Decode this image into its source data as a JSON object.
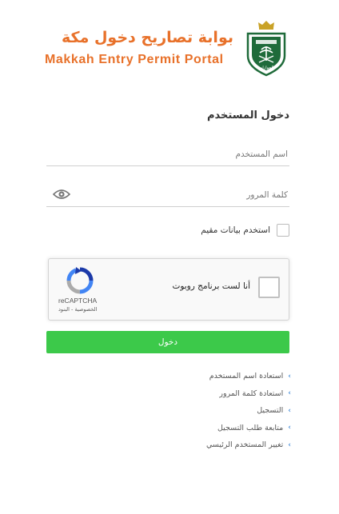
{
  "header": {
    "title_ar": "بوابة تصاريح دخول مكة",
    "title_en": "Makkah Entry Permit Portal",
    "logo_text": "الجوازات"
  },
  "login": {
    "title": "دخول المستخدم",
    "username_placeholder": "اسم المستخدم",
    "password_placeholder": "كلمة المرور",
    "resident_label": "استخدم بيانات مقيم",
    "submit_label": "دخول"
  },
  "captcha": {
    "label": "أنا لست برنامج روبوت",
    "brand": "reCAPTCHA",
    "links": "الخصوصية - البنود"
  },
  "links": [
    {
      "label": "استعادة اسم المستخدم",
      "icon": "chevron-left-icon"
    },
    {
      "label": "استعادة كلمة المرور",
      "icon": "chevron-left-icon"
    },
    {
      "label": "التسجيل",
      "icon": "chevron-left-icon"
    },
    {
      "label": "متابعة طلب التسجيل",
      "icon": "chevron-left-icon"
    },
    {
      "label": "تغيير المستخدم الرئيسي",
      "icon": "chevron-left-icon"
    }
  ],
  "colors": {
    "brand_orange": "#e8712a",
    "emblem_green": "#1f6b3a",
    "button_green": "#3cc94a",
    "link_chevron": "#4a90d9"
  }
}
